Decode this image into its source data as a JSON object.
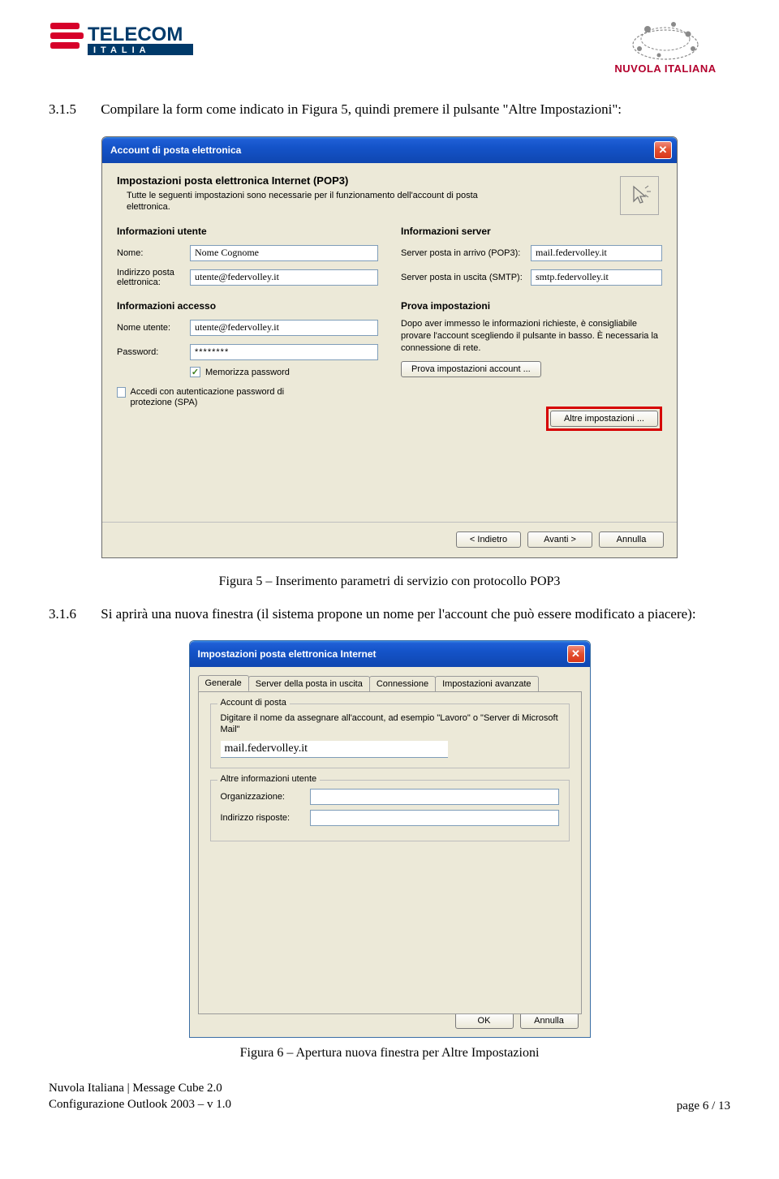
{
  "header": {
    "telecom_brand": "TELECOM",
    "telecom_sub": "ITALIA",
    "nuvola_brand": "NUVOLA ITALIANA"
  },
  "section315": {
    "num": "3.1.5",
    "text": "Compilare la form come indicato in Figura 5, quindi premere il pulsante \"Altre Impostazioni\":"
  },
  "dialog1": {
    "title": "Account di posta elettronica",
    "heading": "Impostazioni posta elettronica Internet (POP3)",
    "sub": "Tutte le seguenti impostazioni sono necessarie per il funzionamento dell'account di posta elettronica.",
    "groups": {
      "utente": "Informazioni utente",
      "server": "Informazioni server",
      "accesso": "Informazioni accesso",
      "prova": "Prova impostazioni"
    },
    "labels": {
      "nome": "Nome:",
      "indirizzo": "Indirizzo posta elettronica:",
      "pop3": "Server posta in arrivo (POP3):",
      "smtp": "Server posta in uscita (SMTP):",
      "nomeutente": "Nome utente:",
      "password": "Password:"
    },
    "values": {
      "nome": "Nome Cognome",
      "indirizzo": "utente@federvolley.it",
      "pop3": "mail.federvolley.it",
      "smtp": "smtp.federvolley.it",
      "nomeutente": "utente@federvolley.it",
      "password": "********"
    },
    "memorizza": "Memorizza password",
    "spa": "Accedi con autenticazione password di protezione (SPA)",
    "prova_text": "Dopo aver immesso le informazioni richieste, è consigliabile provare l'account scegliendo il pulsante in basso. È necessaria la connessione di rete.",
    "prova_button": "Prova impostazioni account ...",
    "altre_button": "Altre impostazioni ...",
    "back": "< Indietro",
    "next": "Avanti >",
    "cancel": "Annulla"
  },
  "caption5": "Figura 5 – Inserimento parametri di servizio con protocollo POP3",
  "section316": {
    "num": "3.1.6",
    "text": "Si aprirà una nuova finestra (il sistema propone un nome per l'account che può essere modificato a piacere):"
  },
  "dialog2": {
    "title": "Impostazioni posta elettronica Internet",
    "tabs": {
      "generale": "Generale",
      "uscita": "Server della posta in uscita",
      "conn": "Connessione",
      "avanzate": "Impostazioni avanzate"
    },
    "fieldset1": {
      "legend": "Account di posta",
      "text": "Digitare il nome da assegnare all'account, ad esempio \"Lavoro\" o \"Server di Microsoft Mail\"",
      "value": "mail.federvolley.it"
    },
    "fieldset2": {
      "legend": "Altre informazioni utente",
      "org": "Organizzazione:",
      "reply": "Indirizzo risposte:"
    },
    "ok": "OK",
    "cancel": "Annulla"
  },
  "caption6": "Figura 6 – Apertura nuova finestra per Altre Impostazioni",
  "footer": {
    "line1": "Nuvola Italiana | Message Cube 2.0",
    "line2": "Configurazione Outlook 2003 – v 1.0",
    "page": "page 6 / 13"
  }
}
